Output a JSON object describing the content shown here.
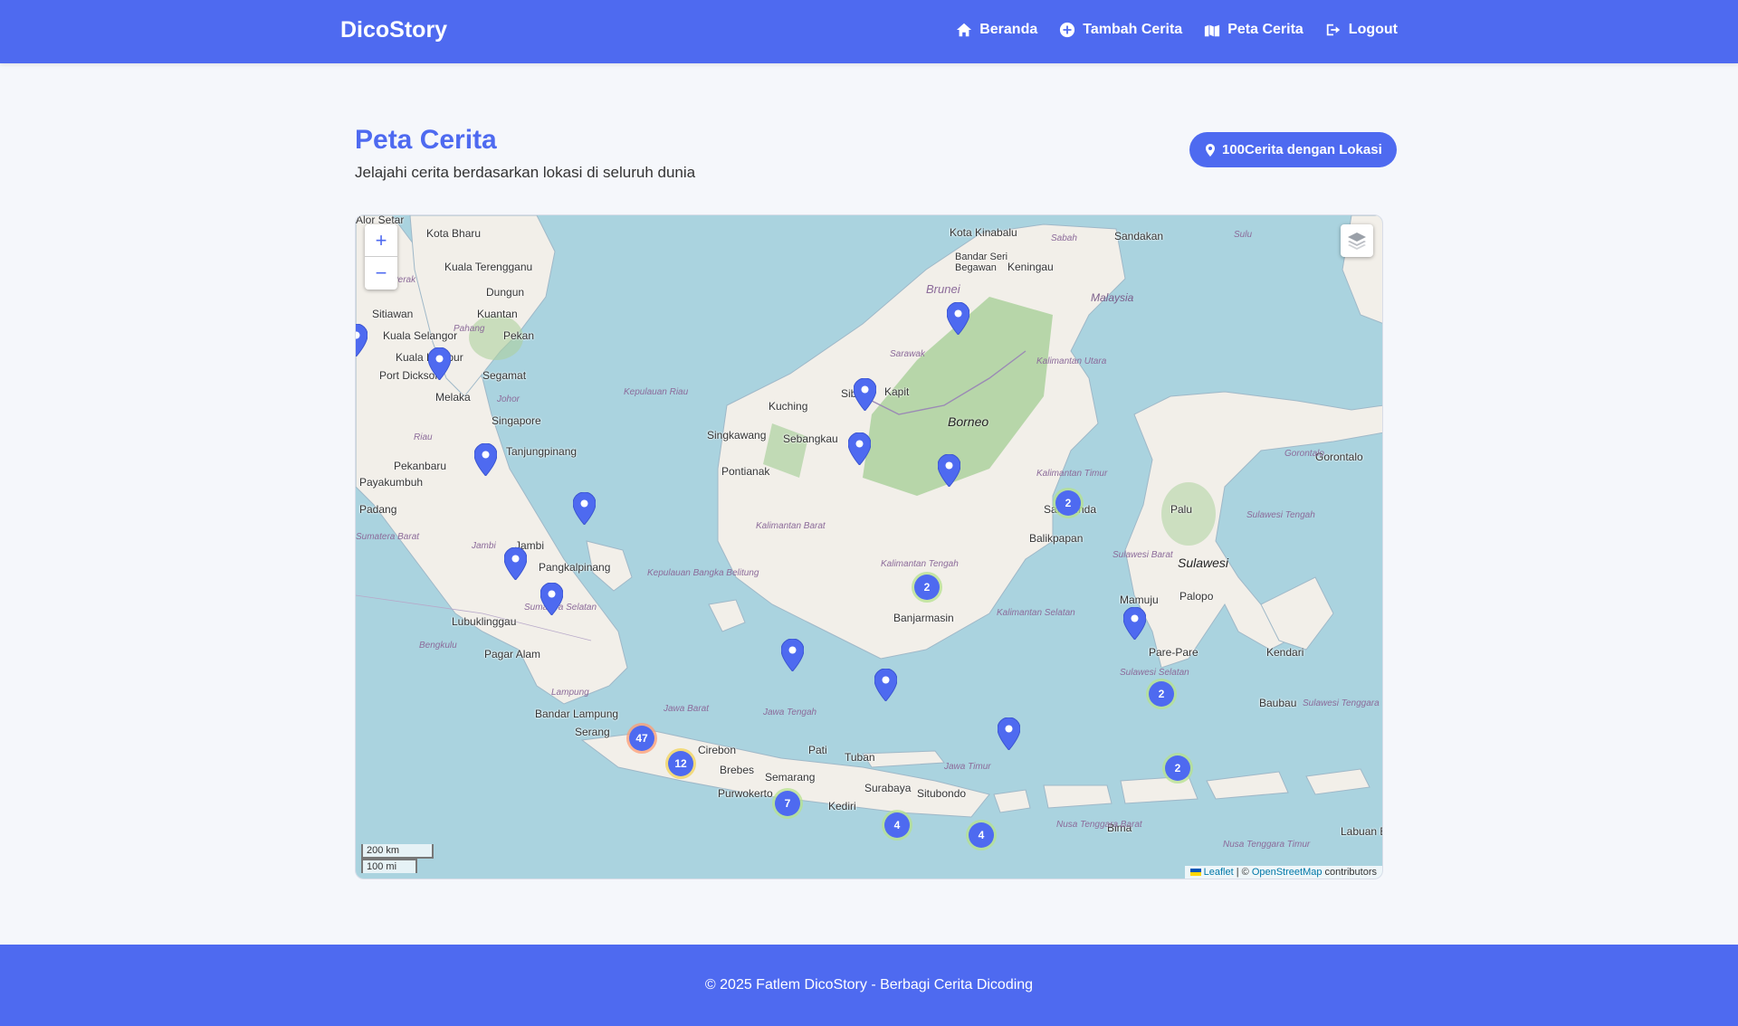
{
  "nav": {
    "brand": "DicoStory",
    "items": [
      {
        "label": "Beranda",
        "icon": "home-icon"
      },
      {
        "label": "Tambah Cerita",
        "icon": "plus-circle-icon"
      },
      {
        "label": "Peta Cerita",
        "icon": "map-icon"
      },
      {
        "label": "Logout",
        "icon": "logout-icon"
      }
    ]
  },
  "header": {
    "title": "Peta Cerita",
    "subtitle": "Jelajahi cerita berdasarkan lokasi di seluruh dunia",
    "badge": "100Cerita dengan Lokasi"
  },
  "map": {
    "zoom_in": "+",
    "zoom_out": "−",
    "scale_km": "200 km",
    "scale_mi": "100 mi",
    "attribution_leaflet": "Leaflet",
    "attribution_sep": " | © ",
    "attribution_osm": "OpenStreetMap",
    "attribution_suffix": " contributors",
    "cities": [
      "Kota Bharu",
      "Kuala Terengganu",
      "Kuantan",
      "Kuala Lumpur",
      "Kuala Selangor",
      "Pekan",
      "Segamat",
      "Port Dickson",
      "Melaka",
      "Singapore",
      "Tanjungpinang",
      "Pekanbaru",
      "Payakumbuh",
      "Padang",
      "Jambi",
      "Pangkalpinang",
      "Lubuklinggau",
      "Pagar Alam",
      "Bandar Lampung",
      "Serang",
      "Cirebon",
      "Brebes",
      "Purwokerto",
      "Semarang",
      "Pati",
      "Tuban",
      "Surabaya",
      "Situbondo",
      "Kediri",
      "Bima",
      "Kota Kinabalu",
      "Sandakan",
      "Keningau",
      "Bandar Seri Begawan",
      "Sibu",
      "Kapit",
      "Kuching",
      "Singkawang",
      "Sebangkau",
      "Pontianak",
      "Banjarmasin",
      "Balikpapan",
      "Samarinda",
      "Palu",
      "Mamuju",
      "Palopo",
      "Pare-Pare",
      "Kendari",
      "Baubau",
      "Gorontalo",
      "Labuan Bajo",
      "Dungun",
      "Sitiawan",
      "Alor Setar"
    ],
    "regions": [
      "Sabah",
      "Sulu",
      "Brunei",
      "Malaysia",
      "Sarawak",
      "Kalimantan Utara",
      "Kalimantan Timur",
      "Kalimantan Barat",
      "Kalimantan Tengah",
      "Kalimantan Selatan",
      "Kepulauan Riau",
      "Riau",
      "Jambi",
      "Sumatera Barat",
      "Sumatera Selatan",
      "Bengkulu",
      "Kepulauan Bangka Belitung",
      "Lampung",
      "Jawa Barat",
      "Jawa Tengah",
      "Jawa Timur",
      "Nusa Tenggara Barat",
      "Nusa Tenggara Timur",
      "Sulawesi Barat",
      "Sulawesi Tengah",
      "Sulawesi Selatan",
      "Sulawesi Tenggara",
      "Gorontalo",
      "Perak",
      "Pahang",
      "Johor"
    ],
    "islands": [
      "Borneo",
      "Sulawesi"
    ],
    "clusters": [
      {
        "count": "47",
        "size": "large"
      },
      {
        "count": "12",
        "size": "medium"
      },
      {
        "count": "7",
        "size": "small"
      },
      {
        "count": "4",
        "size": "small"
      },
      {
        "count": "4",
        "size": "small"
      },
      {
        "count": "2",
        "size": "small"
      },
      {
        "count": "2",
        "size": "small"
      },
      {
        "count": "2",
        "size": "small"
      },
      {
        "count": "2",
        "size": "small"
      }
    ],
    "marker_count": 14,
    "colors": {
      "sea": "#aad3df",
      "land": "#f2efe9",
      "forest": "#add19e",
      "marker": "#4e6af0"
    }
  },
  "footer": {
    "text": "© 2025 Fatlem DicoStory - Berbagi Cerita Dicoding"
  }
}
